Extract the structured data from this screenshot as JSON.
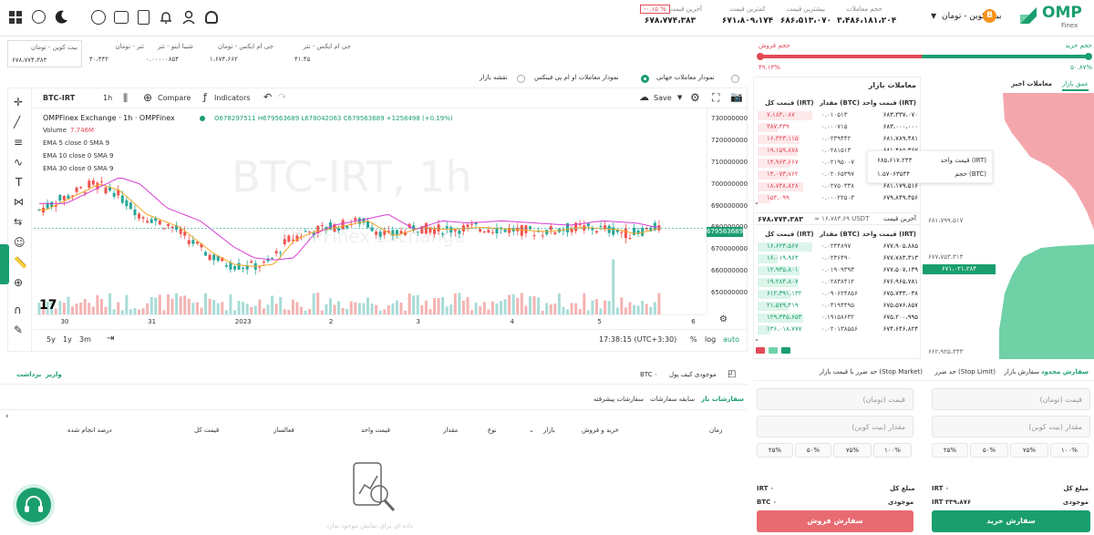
{
  "header": {
    "logo_text": "OMP",
    "logo_sub": "Finex",
    "pair_title": "بیت کوین - تومان",
    "stats": [
      {
        "label": "حجم معاملات",
        "value": "۳،۴۸۶،۱۸۱،۲۰۴"
      },
      {
        "label": "بیشترین قیمت",
        "value": "۶۸۶،۵۱۳،۰۷۰"
      },
      {
        "label": "کمترین قیمت",
        "value": "۶۷۱،۸۰۹،۱۷۴"
      },
      {
        "label": "آخرین قیمت",
        "value": "۶۷۸،۷۷۴،۳۸۳"
      }
    ],
    "change_badge": "-۰.۱۵ %"
  },
  "tickers": [
    {
      "name": "بیت کوین - تومان",
      "price": "۶۷۸،۷۷۴،۳۸۳"
    },
    {
      "name": "تتر - تومان",
      "price": "۴۰،۴۴۲"
    },
    {
      "name": "شیبا اینو - تتر",
      "price": "۰.۰۰۰۰۰۸۵۴"
    },
    {
      "name": "جی ام ایکس - تومان",
      "price": "۱،۶۷۴،۶۶۲"
    },
    {
      "name": "جی ام ایکس - تتر",
      "price": "۴۱.۴۵"
    }
  ],
  "chart_options": [
    {
      "label": "نمودار معاملات جهانی",
      "selected": false
    },
    {
      "label": "نمودار معاملات او ام پی فینکس",
      "selected": true
    },
    {
      "label": "نقشه بازار",
      "selected": false
    }
  ],
  "toolbar": {
    "symbol": "BTC-IRT",
    "interval": "1h",
    "compare": "Compare",
    "indicators": "Indicators",
    "save": "Save"
  },
  "chart_legend": {
    "title": "OMPFinex Exchange · 1h · OMPFinex",
    "ohlc": "O678297511 H679563689 L678042063 C679563689 +1258498 (+0.19%)",
    "volume": "Volume",
    "volume_val": "7.746M",
    "ema": [
      "EMA 5 close 0 SMA 9",
      "EMA 10 close 0 SMA 9",
      "EMA 30 close 0 SMA 9"
    ],
    "watermark": "BTC-IRT, 1h",
    "watermark2": "OMPFinex Exchange"
  },
  "chart_data": {
    "type": "candlestick",
    "x_labels": [
      "30",
      "31",
      "2023",
      "2",
      "3",
      "4",
      "5",
      "6"
    ],
    "y_labels": [
      "730000000",
      "720000000",
      "710000000",
      "700000000",
      "690000000",
      "680000000",
      "670000000",
      "660000000",
      "650000000"
    ],
    "ylim": [
      645000000,
      733000000
    ],
    "last_price_label": "679563689",
    "bottom_time": "17:38:15 (UTC+3:30)",
    "ranges": [
      "5y",
      "1y",
      "3m"
    ],
    "scale_opts": [
      "%",
      "log",
      "auto"
    ]
  },
  "orderbook": {
    "title": "معاملات بازار",
    "tabs": [
      "عمق بازار",
      "معاملات اخیر"
    ],
    "headers": [
      "قیمت واحد (IRT)",
      "مقدار (BTC)",
      "قیمت کل (IRT)"
    ],
    "asks": [
      [
        "۶۸۳،۳۳۷،۰۷۰",
        "۰.۰۱۰۵۱۳",
        "۷،۱۸۳،۰۸۷"
      ],
      [
        "۶۸۳،۰۰۰،۰۰۰",
        "۰.۰۰۰۷۱۵",
        "۴۸۷،۴۳۹"
      ],
      [
        "۶۸۱،۷۸۹،۴۸۱",
        "۰.۰۲۳۹۴۴۲",
        "۱۶،۳۲۳،۱۱۵"
      ],
      [
        "۶۸۱،۴۸۵،۳۶۷",
        "۰.۰۲۸۱۵۱۳",
        "۱۹،۱۵۹،۸۷۸"
      ],
      [
        "۶۸۱،۳۱۲،۱۸۹",
        "۰.۰۲۱۹۵۰۰۷",
        "۱۴،۹۶۳،۶۶۷"
      ],
      [
        "۶۸۱،۲۶۱،۳۴۸",
        "۰.۰۲۰۶۵۳۹۷",
        "۱۴،۰۷۳،۷۶۲"
      ],
      [
        "۶۸۱،۱۷۹،۵۱۶",
        "۰.۰۲۷۵۰۳۳۸",
        "۱۸،۷۴۸،۸۲۸"
      ],
      [
        "۶۷۹،۸۴۹،۳۵۶",
        "۰.۰۰۰۲۲۵۰۳",
        "۱۵۳،۰۹۹"
      ]
    ],
    "last_label": "آخرین قیمت",
    "last_price": "۶۷۸،۷۷۴،۳۸۳",
    "last_usdt": "≈ ۱۶،۷۸۳.۶۹ USDT",
    "bids": [
      [
        "۶۷۷،۹۰۵،۸۸۵",
        "۰.۰۲۴۴۸۹۷",
        "۱۶،۶۲۴،۵۶۷"
      ],
      [
        "۶۷۷،۷۸۳،۳۱۳",
        "۰.۰۲۳۶۴۹۰",
        "۱۶،۰۱۹،۹۶۳"
      ],
      [
        "۶۷۷،۵۰۷،۱۳۹",
        "۰.۰۱۹۰۹۳۹۳",
        "۱۲،۹۳۵،۸۰۱"
      ],
      [
        "۶۷۶،۹۶۵،۷۸۱",
        "۰.۰۲۸۳۸۴۱۲",
        "۱۹،۲۸۴،۸۰۷"
      ],
      [
        "۶۷۵،۷۴۳،۰۳۸",
        "۰.۰۹۰۶۲۴۸۵۶",
        "۶۱۲،۳۹۱،۱۳۲"
      ],
      [
        "۶۷۵،۵۷۶،۸۵۷",
        "۰.۰۳۱۹۴۴۹۵",
        "۲۱،۵۷۹،۴۱۹"
      ],
      [
        "۶۷۵،۲۰۰،۹۹۵",
        "۰.۱۹۱۵۸۶۳۲",
        "۱۲۹،۳۴۵،۶۵۳"
      ],
      [
        "۶۷۴،۶۴۶،۸۲۴",
        "۰.۰۲۰۱۳۸۵۵۶",
        "۱۳۶،۰۱۸،۷۷۷"
      ]
    ],
    "tooltip": {
      "price_label": "قیمت واحد (IRT)",
      "price": "۶۸۵،۶۱۷،۲۴۳",
      "vol_label": "حجم (BTC)",
      "vol": "۱.۵۷۰۶۳۵۴۴"
    }
  },
  "depth": {
    "buy_label": "حجم خرید",
    "buy_pct": "۵۰.۸۷%",
    "sell_label": "حجم فروش",
    "sell_pct": "۴۹.۱۳%",
    "buy_share": 0.5087,
    "prices": [
      "۶۸۸،۸۵۹،۷۱۴",
      "۶۸۱،۷۹۹،۵۱۷",
      "۶۷۷،۷۵۳،۳۱۳",
      "۶۷۱،۰۲۱،۲۸۴",
      "۶۶۲،۹۲۵،۴۴۳"
    ]
  },
  "order_form": {
    "tabs": [
      "سفارش محدود",
      "سفارش بازار",
      "حد ضرر (Stop Limit)",
      "حد ضرر با قیمت بازار (Stop Market)"
    ],
    "buy_price_ph": "قیمت (تومان)",
    "buy_amount_ph": "مقدار (بیت کوین)",
    "sell_price_ph": "قیمت (تومان)",
    "sell_amount_ph": "مقدار (بیت کوین)",
    "percents": [
      "۱۰۰%",
      "۷۵%",
      "۵۰%",
      "۲۵%"
    ],
    "total_label": "مبلغ کل",
    "buy_total": "IRT ۰",
    "sell_total": "IRT ۰",
    "balance_label": "موجودی",
    "buy_balance": "IRT ۳۳۹،۸۷۶",
    "sell_balance": "BTC ۰",
    "buy_button": "سفارش خرید",
    "sell_button": "سفارش فروش"
  },
  "wallet": {
    "deposit": "واریز",
    "withdraw": "برداشت",
    "balance_label": "موجودی کیف پول",
    "balance": "BTC ۰"
  },
  "orders": {
    "tabs": [
      "سفارشات باز",
      "سابقه سفارشات",
      "سفارشات پیشرفته"
    ],
    "filter": "بازار",
    "columns": [
      "زمان",
      "خرید و فروش",
      "نوع",
      "مقدار",
      "قیمت واحد",
      "فعالساز",
      "قیمت کل",
      "درصد انجام شده"
    ],
    "empty": "داده ای برای نمایش موجود ندارد"
  },
  "colors": {
    "green": "#1a9e6e",
    "red": "#e24a56",
    "pink": "#f4a6ad",
    "lightgreen": "#6fd1a6"
  }
}
